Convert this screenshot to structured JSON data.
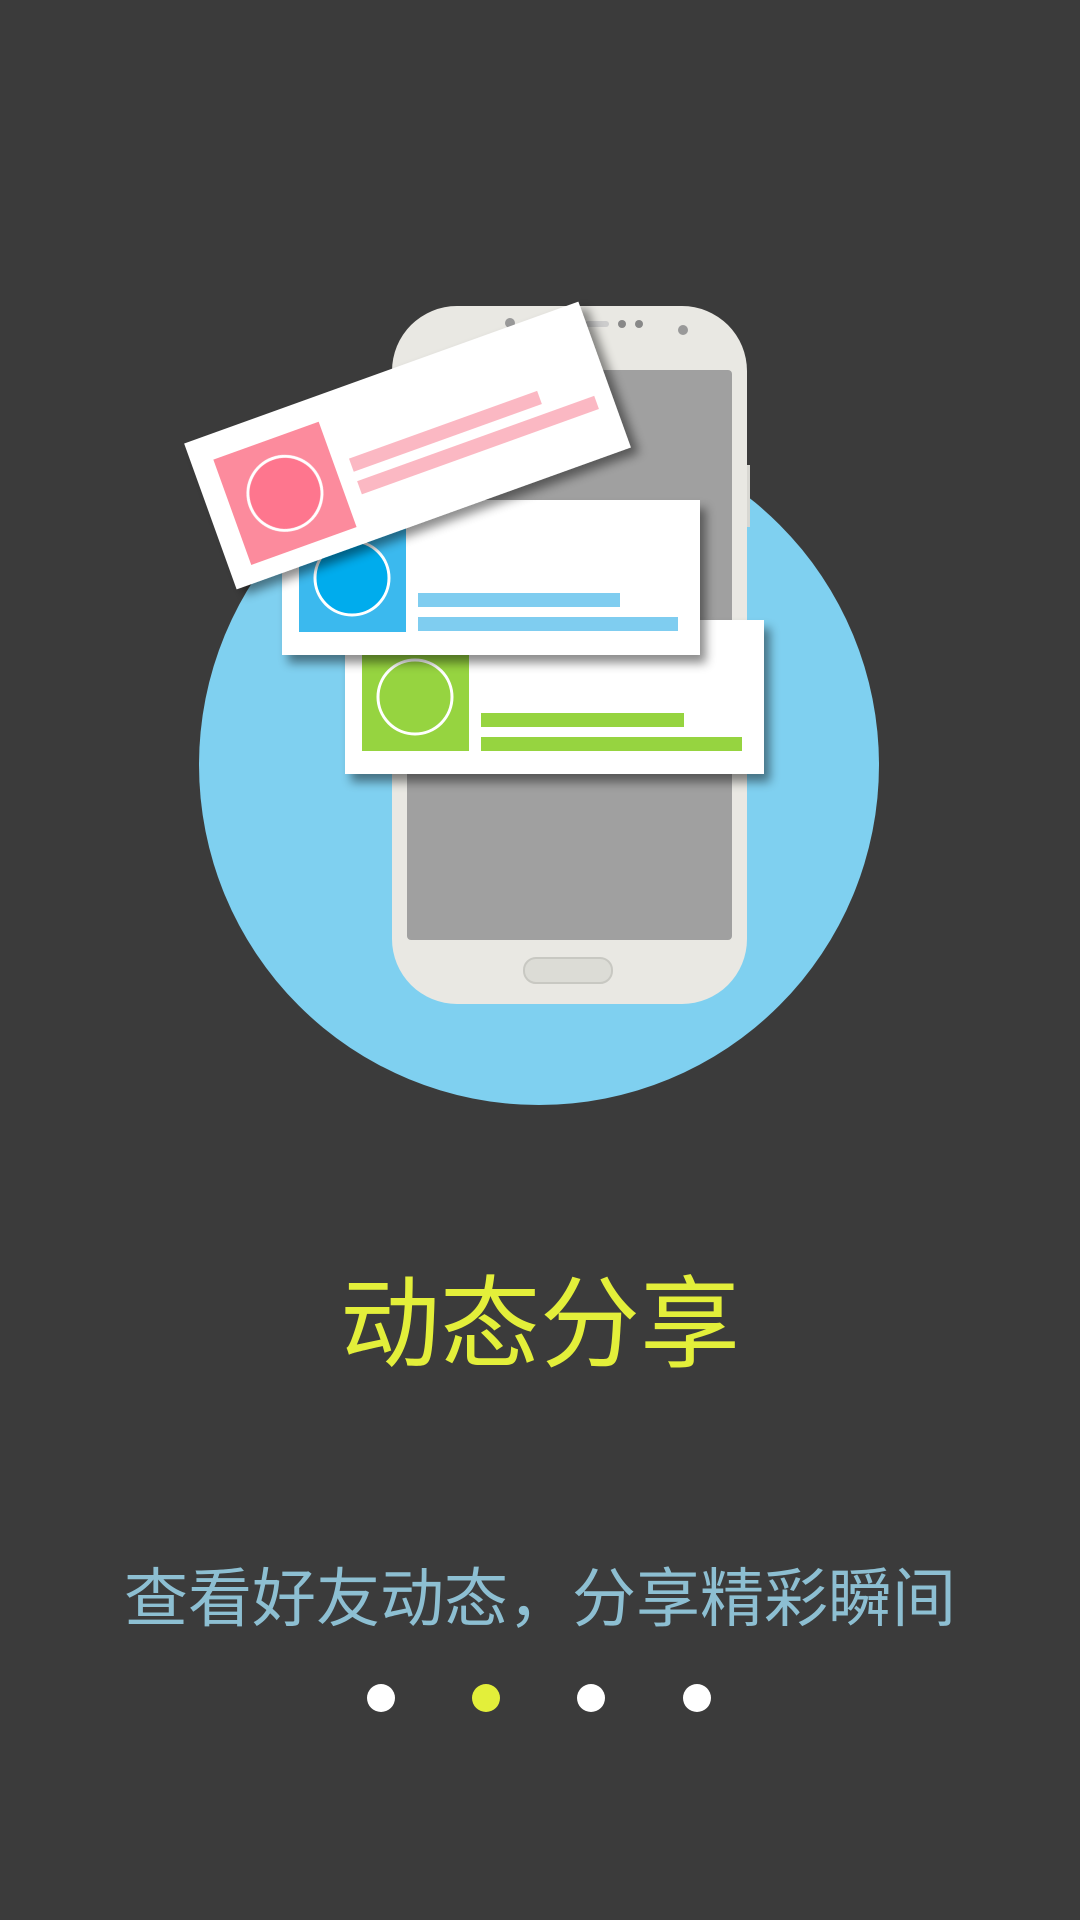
{
  "onboarding": {
    "title": "动态分享",
    "subtitle": "查看好友动态，分享精彩瞬间",
    "illustration": "phone-with-feed-cards",
    "page_indicator": {
      "total": 4,
      "active_index": 1
    }
  },
  "colors": {
    "background": "#3b3b3b",
    "circle": "#7fd0f0",
    "title": "#e3ef3a",
    "subtitle": "#8dbfd2",
    "dot_active": "#e3ef3a",
    "dot_inactive": "#ffffff",
    "pink": "#fc8b9d",
    "blue": "#3bb9ee",
    "green": "#96d43f"
  }
}
